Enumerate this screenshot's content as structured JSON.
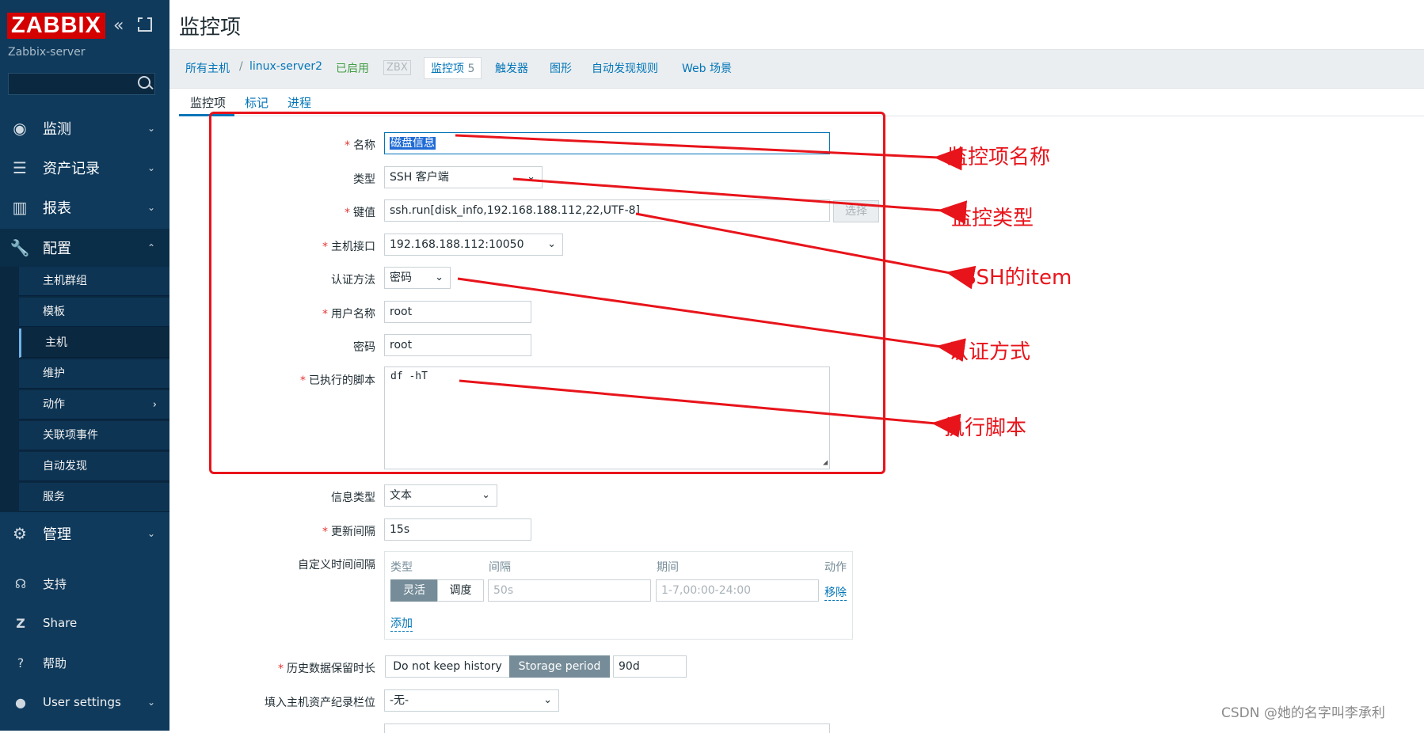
{
  "sidebar": {
    "logo": "ZABBIX",
    "server_name": "Zabbix-server",
    "menu": [
      {
        "label": "监测",
        "icon": "eye-icon"
      },
      {
        "label": "资产记录",
        "icon": "list-icon"
      },
      {
        "label": "报表",
        "icon": "bar-chart-icon"
      },
      {
        "label": "配置",
        "icon": "wrench-icon"
      },
      {
        "label": "管理",
        "icon": "gear-icon"
      }
    ],
    "submenu": [
      "主机群组",
      "模板",
      "主机",
      "维护",
      "动作",
      "关联项事件",
      "自动发现",
      "服务"
    ],
    "bottom": [
      {
        "label": "支持",
        "icon": "headset-icon"
      },
      {
        "label": "Share",
        "icon": "share-icon"
      },
      {
        "label": "帮助",
        "icon": "help-icon"
      },
      {
        "label": "User settings",
        "icon": "user-icon"
      }
    ]
  },
  "page": {
    "title": "监控项",
    "breadcrumb": {
      "all_hosts": "所有主机",
      "sep": "/",
      "host": "linux-server2",
      "status": "已启用",
      "zbx": "ZBX",
      "items": "监控项",
      "items_count": "5",
      "triggers": "触发器",
      "graphs": "图形",
      "discovery": "自动发现规则",
      "web": "Web 场景"
    },
    "tabs": [
      "监控项",
      "标记",
      "进程"
    ]
  },
  "form": {
    "name_label": "名称",
    "name_value": "磁盘信息",
    "type_label": "类型",
    "type_value": "SSH 客户端",
    "key_label": "键值",
    "key_value": "ssh.run[disk_info,192.168.188.112,22,UTF-8]",
    "choose_button": "选择",
    "interface_label": "主机接口",
    "interface_value": "192.168.188.112:10050",
    "auth_label": "认证方法",
    "auth_value": "密码",
    "username_label": "用户名称",
    "username_value": "root",
    "password_label": "密码",
    "password_value": "root",
    "script_label": "已执行的脚本",
    "script_value": "df -hT",
    "info_type_label": "信息类型",
    "info_type_value": "文本",
    "interval_label": "更新间隔",
    "interval_value": "15s",
    "custom_label": "自定义时间间隔",
    "custom": {
      "col_type": "类型",
      "col_interval": "间隔",
      "col_period": "期间",
      "col_action": "动作",
      "seg_flexible": "灵活",
      "seg_scheduling": "调度",
      "interval_placeholder": "50s",
      "period_placeholder": "1-7,00:00-24:00",
      "remove": "移除",
      "add": "添加"
    },
    "history_label": "历史数据保留时长",
    "history_no_keep": "Do not keep history",
    "history_storage": "Storage period",
    "history_value": "90d",
    "inventory_label": "填入主机资产纪录栏位",
    "inventory_value": "-无-"
  },
  "annotations": {
    "a1": "监控项名称",
    "a2": "监控类型",
    "a3": "SSH的item",
    "a4": "认证方式",
    "a5": "执行脚本",
    "color": "#e8141b"
  },
  "watermark": "CSDN @她的名字叫李承利"
}
